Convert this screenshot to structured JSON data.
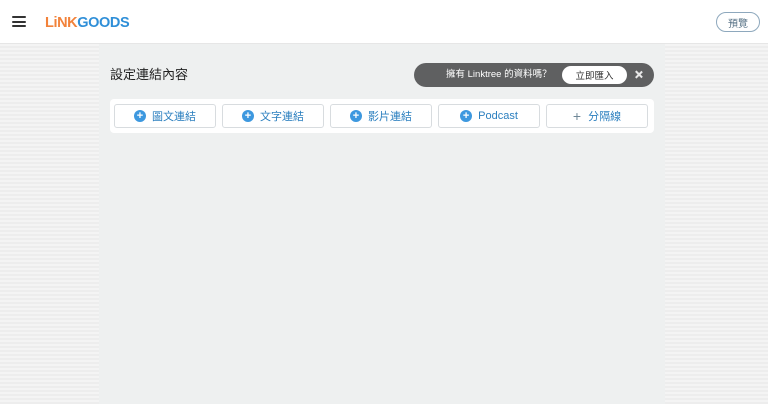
{
  "header": {
    "logo_part1": "LiNK",
    "logo_part2": "GOODS",
    "preview_label": "預覽"
  },
  "content": {
    "section_title": "設定連結內容"
  },
  "import_banner": {
    "text": "擁有 Linktree 的資料嗎？",
    "button_label": "立即匯入"
  },
  "toolbar": {
    "buttons": [
      {
        "label": "圖文連結",
        "icon": "plus-circle-icon"
      },
      {
        "label": "文字連結",
        "icon": "plus-circle-icon"
      },
      {
        "label": "影片連結",
        "icon": "plus-circle-icon"
      },
      {
        "label": "Podcast",
        "icon": "plus-circle-icon"
      },
      {
        "label": "分隔線",
        "icon": "plus-icon"
      }
    ]
  },
  "colors": {
    "accent_blue": "#3d98df",
    "logo_orange": "#f2823a",
    "banner_bg": "#5f6061"
  }
}
